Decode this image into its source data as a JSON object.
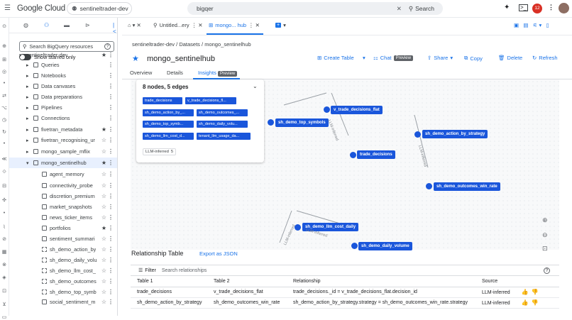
{
  "topbar": {
    "brand": "Google Cloud",
    "project": "sentineltrader-dev",
    "search_value": "bigqer",
    "search_button": "Search",
    "notification_count": "12"
  },
  "explorer": {
    "search_placeholder": "Search BigQuery resources",
    "show_starred": "Show starred only",
    "items": [
      {
        "label": "sentineltrader-dev",
        "starred": true
      },
      {
        "label": "Queries"
      },
      {
        "label": "Notebooks"
      },
      {
        "label": "Data canvases"
      },
      {
        "label": "Data preparations"
      },
      {
        "label": "Pipelines"
      },
      {
        "label": "Connections"
      },
      {
        "label": "fivetran_metadata",
        "starred": true
      },
      {
        "label": "fivetran_recognising_ur"
      },
      {
        "label": "mongo_sample_mflix"
      },
      {
        "label": "mongo_sentinelhub",
        "starred": true
      },
      {
        "label": "agent_memory"
      },
      {
        "label": "connectivity_probe"
      },
      {
        "label": "discretion_premium"
      },
      {
        "label": "market_snapshots"
      },
      {
        "label": "news_ticker_items"
      },
      {
        "label": "portfolios",
        "starred": true
      },
      {
        "label": "sentiment_summari"
      },
      {
        "label": "sh_demo_action_by"
      },
      {
        "label": "sh_demo_daily_volu"
      },
      {
        "label": "sh_demo_llm_cost_"
      },
      {
        "label": "sh_demo_outcomes"
      },
      {
        "label": "sh_demo_top_symb"
      },
      {
        "label": "social_sentiment_m"
      }
    ]
  },
  "tabs": [
    {
      "label": "Untitled...ery"
    },
    {
      "label": "mongo... hub"
    }
  ],
  "breadcrumb": {
    "project": "sentineltrader-dev",
    "sep1": "/",
    "datasets": "Datasets",
    "sep2": "/",
    "current": "mongo_sentinelhub"
  },
  "header": {
    "title": "mongo_sentinelhub"
  },
  "actions": {
    "create_table": "Create Table",
    "chat": "Chat",
    "chat_badge": "Preview",
    "share": "Share",
    "copy": "Copy",
    "delete": "Delete",
    "refresh": "Refresh"
  },
  "subtabs": {
    "overview": "Overview",
    "details": "Details",
    "insights": "Insights",
    "insights_badge": "Preview"
  },
  "graph": {
    "summary_title": "8 nodes, 5 edges",
    "chips": [
      "trade_decisions",
      "v_trade_decisions_fl...",
      "sh_demo_action_by_...",
      "sh_demo_outcomes_...",
      "sh_demo_top_symb...",
      "sh_demo_daily_volu...",
      "sh_demo_llm_cost_d...",
      "tenant_llm_usage_da..."
    ],
    "llm_chip": "LLM-inferred",
    "llm_chip_count": "5",
    "nodes": {
      "v_trade_decisions_flat": "v_trade_decisions_flat",
      "sh_demo_top_symbols": "sh_demo_top_symbols",
      "trade_decisions": "trade_decisions",
      "sh_demo_action_by_strategy": "sh_demo_action_by_strategy",
      "sh_demo_outcomes_win_rate": "sh_demo_outcomes_win_rate",
      "sh_demo_llm_cost_daily": "sh_demo_llm_cost_daily",
      "sh_demo_daily_volume": "sh_demo_daily_volume"
    },
    "edge_label": "LLM-inferred"
  },
  "relationships": {
    "title": "Relationship Table",
    "export": "Export as JSON",
    "filter_label": "Filter",
    "filter_placeholder": "Search relationships",
    "headers": [
      "Table 1",
      "Table 2",
      "Relationship",
      "Source"
    ],
    "rows": [
      [
        "trade_decisions",
        "v_trade_decisions_flat",
        "trade_decisions._id = v_trade_decisions_flat.decision_id",
        "LLM-inferred"
      ],
      [
        "sh_demo_action_by_strategy",
        "sh_demo_outcomes_win_rate",
        "sh_demo_action_by_strategy.strategy = sh_demo_outcomes_win_rate.strategy",
        "LLM-inferred"
      ]
    ]
  },
  "colors": {
    "accent": "#1a73e8",
    "node": "#1a56db",
    "avatar_badge": "#d93025"
  }
}
